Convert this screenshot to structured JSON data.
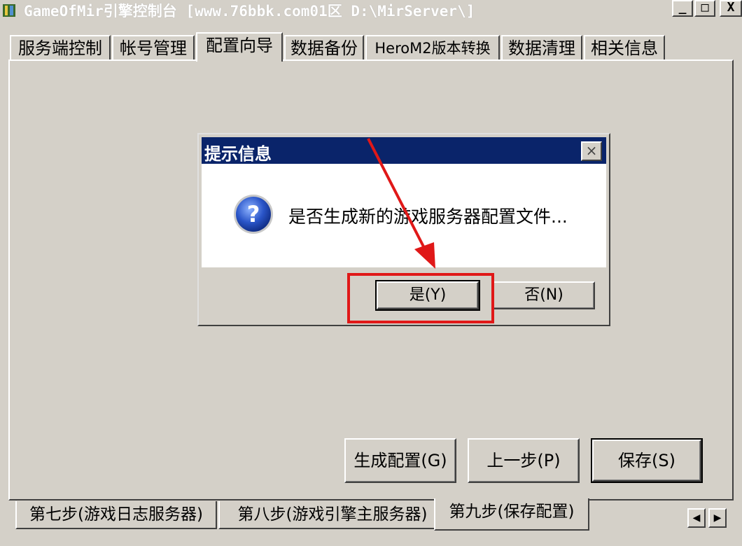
{
  "window": {
    "title": "GameOfMir引擎控制台 [www.76bbk.com01区 D:\\MirServer\\]",
    "buttons": {
      "minimize": "_",
      "maximize": "□",
      "close": "X"
    }
  },
  "top_tabs": [
    {
      "label": "服务端控制"
    },
    {
      "label": "帐号管理"
    },
    {
      "label": "配置向导"
    },
    {
      "label": "数据备份"
    },
    {
      "label": "HeroM2版本转换"
    },
    {
      "label": "数据清理"
    },
    {
      "label": "相关信息"
    }
  ],
  "active_top_tab": "配置向导",
  "dialog": {
    "title": "提示信息",
    "message": "是否生成新的游戏服务器配置文件...",
    "close_glyph": "×",
    "yes_label": "是(Y)",
    "no_label": "否(N)"
  },
  "action_buttons": {
    "generate": "生成配置(G)",
    "previous": "上一步(P)",
    "save": "保存(S)"
  },
  "bottom_tabs": [
    {
      "label": "第七步(游戏日志服务器)"
    },
    {
      "label": "第八步(游戏引擎主服务器)"
    },
    {
      "label": "第九步(保存配置)"
    }
  ],
  "active_bottom_tab": "第九步(保存配置)",
  "scroll": {
    "left": "◀",
    "right": "▶"
  },
  "annotation": {
    "color": "#e01818"
  },
  "icons": {
    "app": "game-app-icon",
    "question": "question-icon"
  }
}
